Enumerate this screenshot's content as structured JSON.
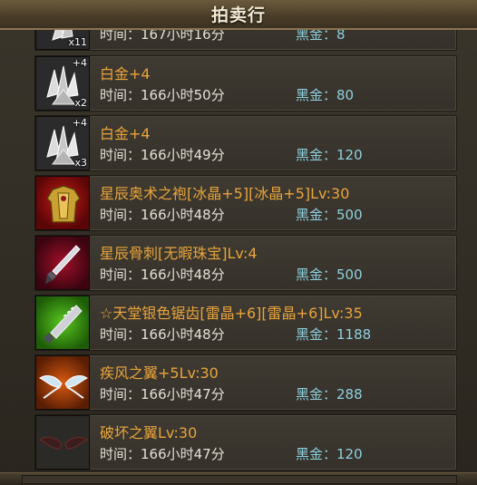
{
  "window": {
    "title": "拍卖行"
  },
  "listings": [
    {
      "name": "",
      "time": "时间：167小时16分",
      "price": "黑金：8",
      "qty": "x11",
      "plus": "",
      "icon": "platinum-ore-icon"
    },
    {
      "name": "白金+4",
      "time": "时间：166小时50分",
      "price_label": "黑金：",
      "price_value": "80",
      "qty": "x2",
      "plus": "+4",
      "icon": "platinum-ore-icon"
    },
    {
      "name": "白金+4",
      "time": "时间：166小时49分",
      "price_label": "黑金：",
      "price_value": "120",
      "qty": "x3",
      "plus": "+4",
      "icon": "platinum-ore-icon"
    },
    {
      "name": "星辰奥术之袍[冰晶+5][冰晶+5]Lv:30",
      "time": "时间：166小时48分",
      "price_label": "黑金：",
      "price_value": "500",
      "qty": "",
      "plus": "",
      "icon": "robe-icon"
    },
    {
      "name": "星辰骨刺[无暇珠宝]Lv:4",
      "time": "时间：166小时48分",
      "price_label": "黑金：",
      "price_value": "500",
      "qty": "",
      "plus": "",
      "icon": "dagger-icon"
    },
    {
      "name": "☆天堂银色锯齿[雷晶+6][雷晶+6]Lv:35",
      "time": "时间：166小时48分",
      "price_label": "黑金：",
      "price_value": "1188",
      "qty": "",
      "plus": "",
      "icon": "serrated-blade-icon"
    },
    {
      "name": "疾风之翼+5Lv:30",
      "time": "时间：166小时47分",
      "price_label": "黑金：",
      "price_value": "288",
      "qty": "",
      "plus": "",
      "icon": "wings-icon"
    },
    {
      "name": "破坏之翼Lv:30",
      "time": "时间：166小时47分",
      "price_label": "黑金：",
      "price_value": "120",
      "qty": "",
      "plus": "",
      "icon": "dark-wings-icon"
    }
  ],
  "colors": {
    "item_name": "#e9a43a",
    "price": "#8ed0de",
    "time": "#e3e0d8"
  }
}
